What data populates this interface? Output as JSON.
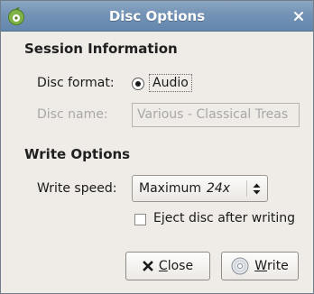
{
  "window": {
    "title": "Disc Options",
    "app_icon": "brasero-icon",
    "close_icon": "close-icon",
    "titlebar_color": "#7393b5"
  },
  "session": {
    "heading": "Session Information",
    "format_label": "Disc format:",
    "format_value": "Audio",
    "format_selected": true,
    "name_label": "Disc name:",
    "name_value": "Various - Classical Treas",
    "name_enabled": false
  },
  "write": {
    "heading": "Write Options",
    "speed_label": "Write speed:",
    "speed_value": "Maximum",
    "speed_rate": "24x",
    "eject_label": "Eject disc after writing",
    "eject_checked": false
  },
  "buttons": {
    "close_mnemonic": "C",
    "close_rest": "lose",
    "close_icon": "x-icon",
    "write_mnemonic": "W",
    "write_rest": "rite",
    "write_icon": "disc-icon"
  }
}
